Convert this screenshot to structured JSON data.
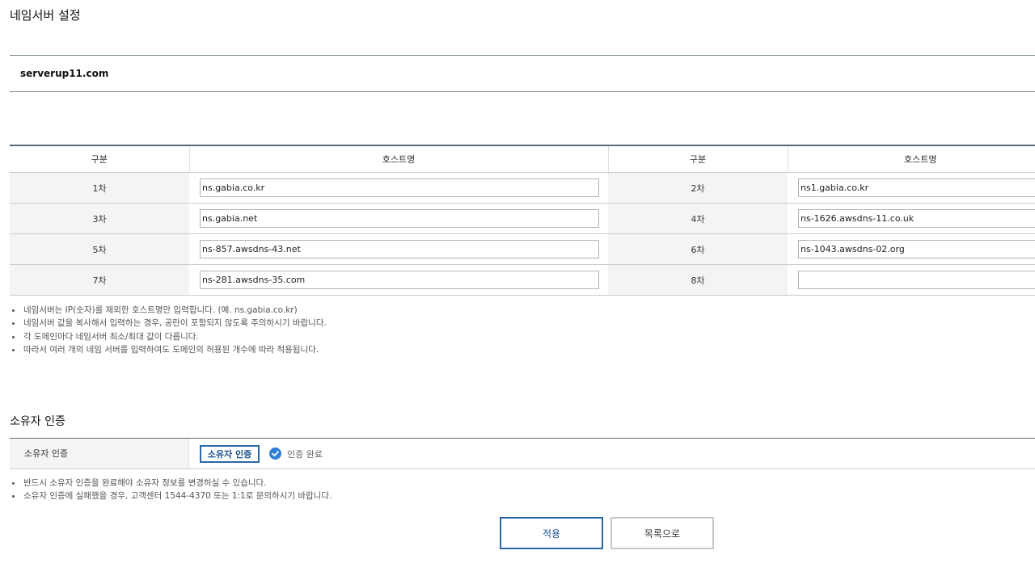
{
  "page_title": "네임서버 설정",
  "domain": "serverup11.com",
  "ns_table": {
    "headers": [
      "구분",
      "호스트명",
      "구분",
      "호스트명"
    ],
    "rows": [
      [
        {
          "label": "1차",
          "value": "ns.gabia.co.kr"
        },
        {
          "label": "2차",
          "value": "ns1.gabia.co.kr"
        }
      ],
      [
        {
          "label": "3차",
          "value": "ns.gabia.net"
        },
        {
          "label": "4차",
          "value": "ns-1626.awsdns-11.co.uk"
        }
      ],
      [
        {
          "label": "5차",
          "value": "ns-857.awsdns-43.net"
        },
        {
          "label": "6차",
          "value": "ns-1043.awsdns-02.org"
        }
      ],
      [
        {
          "label": "7차",
          "value": "ns-281.awsdns-35.com"
        },
        {
          "label": "8차",
          "value": ""
        }
      ]
    ]
  },
  "ns_notes": [
    "네임서버는 IP(숫자)를 제외한 호스트명만 입력합니다. (예. ns.gabia.co.kr)",
    "네임서버 값을 복사해서 입력하는 경우, 공란이 포함되지 않도록 주의하시기 바랍니다.",
    "각 도메인마다 네임서버 최소/최대 값이 다릅니다.",
    "따라서 여러 개의 네임 서버를 입력하여도 도메인의 허용된 개수에 따라 적용됩니다."
  ],
  "owner_section": {
    "title": "소유자 인증",
    "row_label": "소유자 인증",
    "button_label": "소유자 인증",
    "status_icon": "check-circle-icon",
    "status_color": "#2f7fd6",
    "status_text": "인증 완료"
  },
  "owner_notes": [
    "반드시 소유자 인증을 완료해야 소유자 정보를 변경하실 수 있습니다.",
    "소유자 인증에 실패했을 경우, 고객센터 1544-4370 또는 1:1로 문의하시기 바랍니다."
  ],
  "actions": {
    "apply_label": "적용",
    "list_label": "목록으로"
  }
}
